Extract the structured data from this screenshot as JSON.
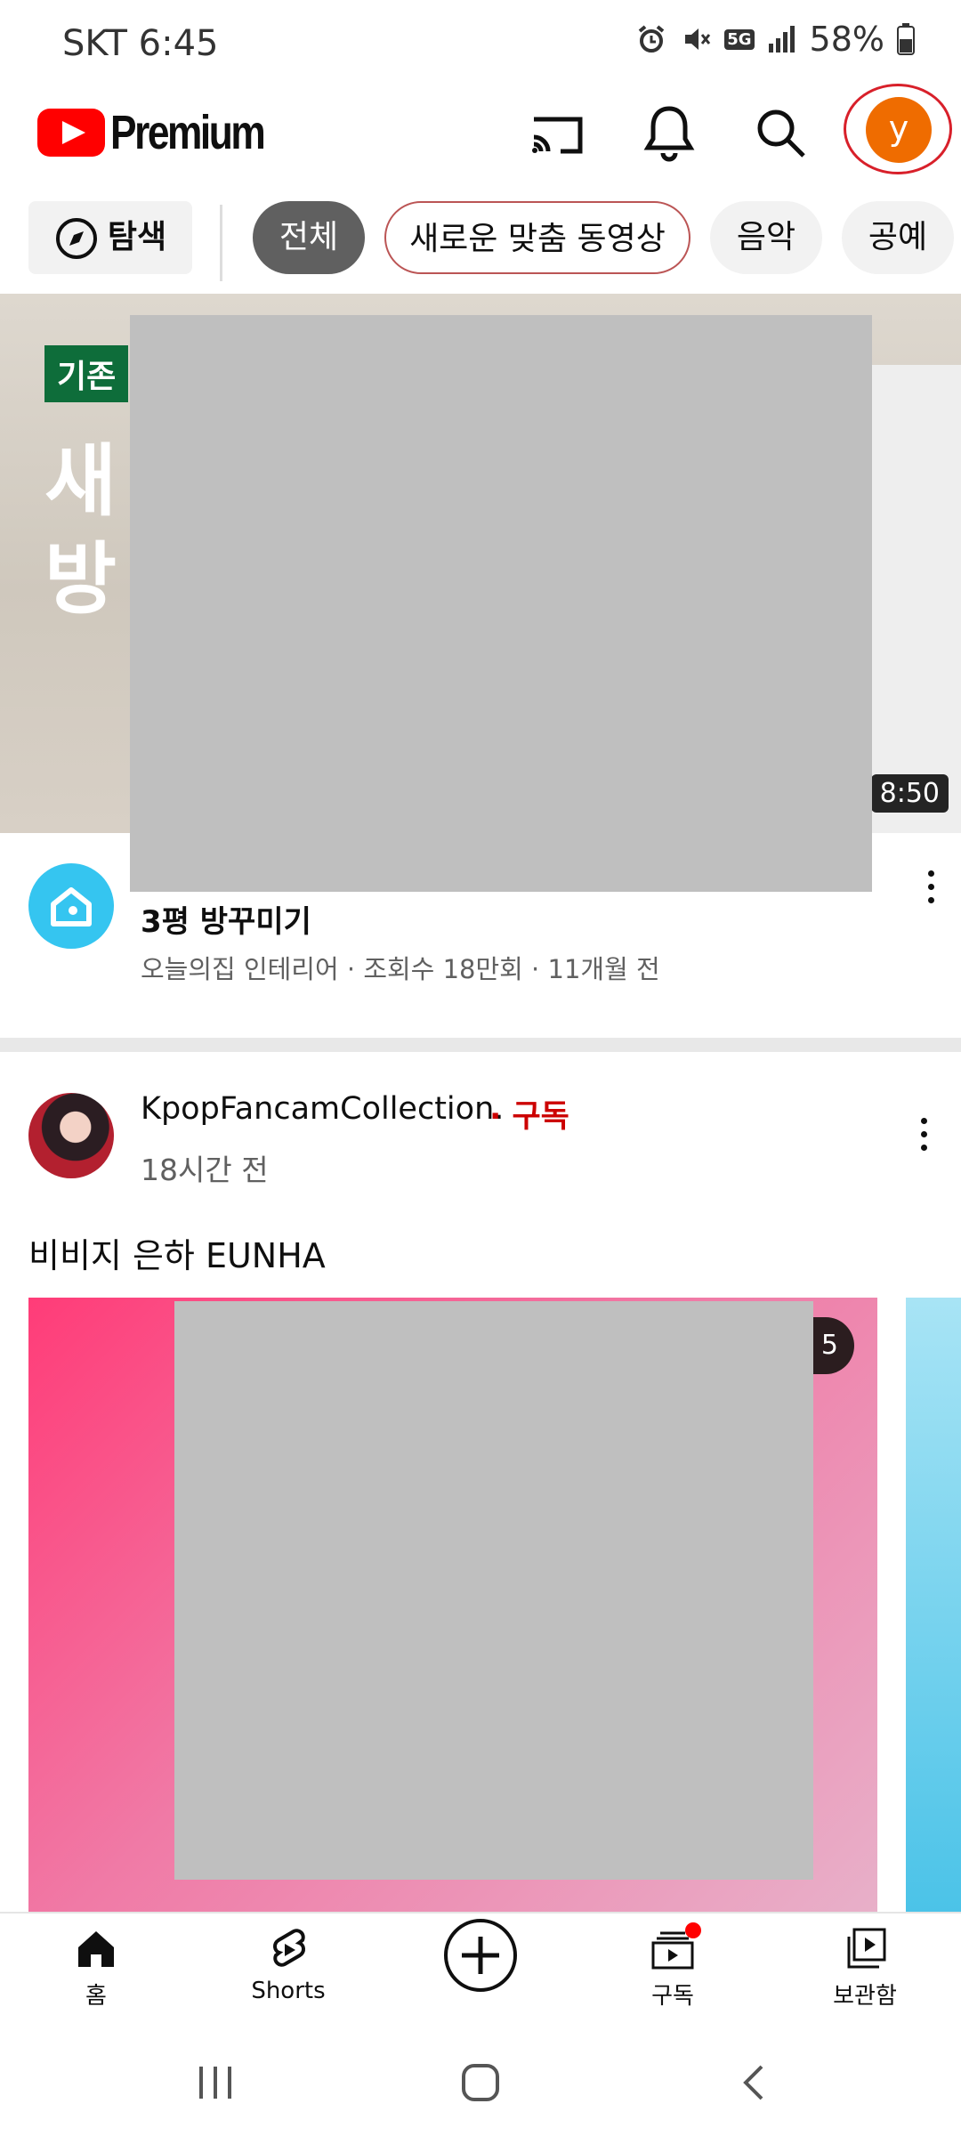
{
  "status_bar": {
    "carrier_time": "SKT 6:45",
    "network": "5G",
    "battery": "58%"
  },
  "app_bar": {
    "brand": "Premium",
    "icons": [
      "cast-icon",
      "bell-icon",
      "search-icon"
    ],
    "avatar_letter": "y"
  },
  "chips": {
    "explore": "탐색",
    "items": [
      "전체",
      "새로운 맞춤 동영상",
      "음악",
      "공예"
    ]
  },
  "video1": {
    "thumb_badge": "기존",
    "thumb_line1": "새",
    "thumb_line2": "방",
    "duration": "8:50",
    "title_line2": "3평 방꾸미기",
    "meta": "오늘의집 인테리어 · 조회수 18만회 · 11개월 전"
  },
  "post": {
    "channel": "KpopFancamCollection.",
    "subscribe": "· 구독",
    "time": "18시간 전",
    "text": "비비지 은하 EUNHA",
    "count_fragment": "5"
  },
  "bottom_nav": {
    "items": [
      {
        "label": "홈",
        "icon": "home-icon"
      },
      {
        "label": "Shorts",
        "icon": "shorts-icon"
      },
      {
        "label": "",
        "icon": "create-icon"
      },
      {
        "label": "구독",
        "icon": "subscriptions-icon"
      },
      {
        "label": "보관함",
        "icon": "library-icon"
      }
    ]
  },
  "colors": {
    "brand_red": "#ff0000",
    "subscribe_red": "#cc0000",
    "avatar_orange": "#ef6c00",
    "active_chip": "#606060"
  }
}
